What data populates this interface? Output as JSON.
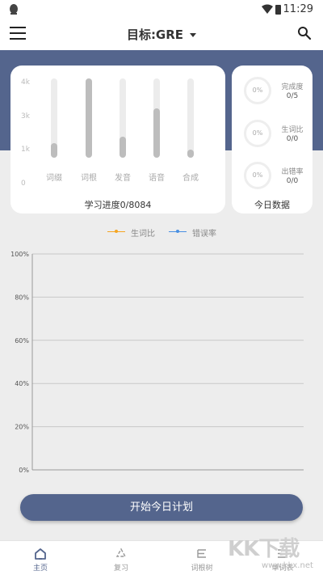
{
  "status_bar": {
    "time": "11:29"
  },
  "app_bar": {
    "title": "目标:GRE"
  },
  "progress_card": {
    "y_axis": [
      "4k",
      "3k",
      "1k",
      "0"
    ],
    "bars": [
      {
        "label": "词缀",
        "fraction": 0.18
      },
      {
        "label": "词根",
        "fraction": 1.0
      },
      {
        "label": "发音",
        "fraction": 0.27
      },
      {
        "label": "语音",
        "fraction": 0.62
      },
      {
        "label": "合成",
        "fraction": 0.1
      }
    ],
    "footer": "学习进度0/8084"
  },
  "today_card": {
    "title": "今日数据",
    "stats": [
      {
        "ring": "0%",
        "label": "完成度",
        "value": "0/5"
      },
      {
        "ring": "0%",
        "label": "生词比",
        "value": "0/0"
      },
      {
        "ring": "0%",
        "label": "出错率",
        "value": "0/0"
      }
    ]
  },
  "chart_data": {
    "type": "line",
    "series": [
      {
        "name": "生词比",
        "color": "#f5a623",
        "values": []
      },
      {
        "name": "错误率",
        "color": "#4a90e2",
        "values": []
      }
    ],
    "y_ticks": [
      "100%",
      "80%",
      "60%",
      "40%",
      "20%",
      "0%"
    ],
    "ylim": [
      0,
      100
    ],
    "grid": true,
    "legend": "top"
  },
  "start_button": {
    "label": "开始今日计划"
  },
  "tabs": [
    {
      "label": "主页",
      "icon": "home-icon"
    },
    {
      "label": "复习",
      "icon": "recycle-icon"
    },
    {
      "label": "词根树",
      "icon": "tree-icon"
    },
    {
      "label": "单词表",
      "icon": "list-icon"
    }
  ],
  "watermark": {
    "text": "KK下载",
    "url": "www.kkx.net"
  },
  "colors": {
    "primary": "#54658d",
    "background": "#ededed"
  }
}
